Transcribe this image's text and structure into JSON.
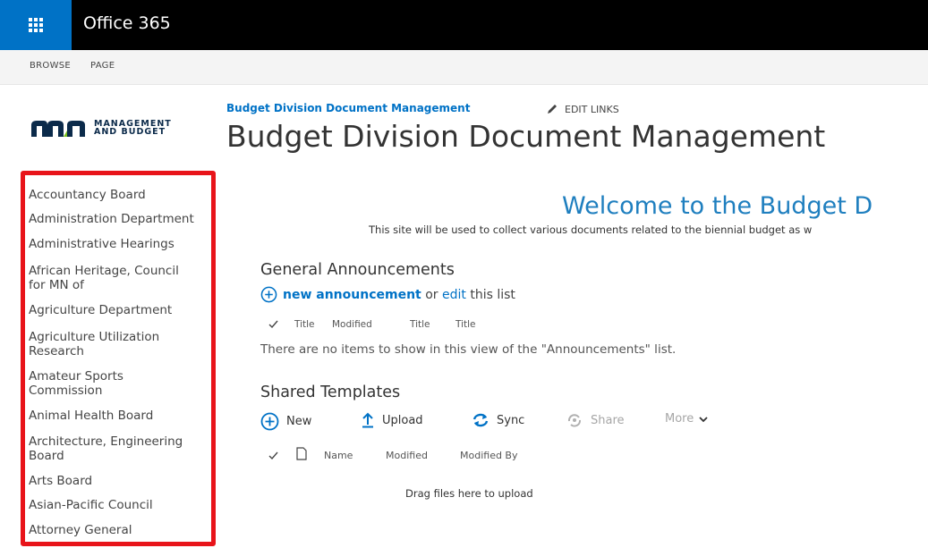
{
  "suite_bar": {
    "title": "Office 365",
    "waffle_icon": "app-launcher-waffle-icon"
  },
  "ribbon": {
    "tabs": [
      "BROWSE",
      "PAGE"
    ]
  },
  "logo": {
    "line1": "MANAGEMENT",
    "line2": "AND BUDGET",
    "brand_color": "#0b2a4a"
  },
  "header": {
    "breadcrumb": "Budget Division Document Management",
    "edit_links": "EDIT LINKS",
    "page_title": "Budget Division Document Management"
  },
  "left_nav": {
    "highlight_color": "#e8141a",
    "items": [
      "Accountancy Board",
      "Administration Department",
      "Administrative Hearings",
      "African Heritage, Council for MN of",
      "Agriculture Department",
      "Agriculture Utilization Research",
      "Amateur Sports Commission",
      "Animal Health Board",
      "Architecture, Engineering Board",
      "Arts Board",
      "Asian-Pacific Council",
      "Attorney General"
    ]
  },
  "welcome": {
    "heading": "Welcome to the Budget D",
    "description": "This site will be used to collect various documents related to the biennial budget as w"
  },
  "announcements": {
    "title": "General Announcements",
    "new_link": "new announcement",
    "or_text": "or",
    "edit_link": "edit",
    "this_list": "this list",
    "columns": [
      "Title",
      "Modified",
      "Title",
      "Title"
    ],
    "empty_message": "There are no items to show in this view of the \"Announcements\" list."
  },
  "templates": {
    "title": "Shared Templates",
    "commands": {
      "new": "New",
      "upload": "Upload",
      "sync": "Sync",
      "share": "Share",
      "more": "More"
    },
    "columns": {
      "name": "Name",
      "modified": "Modified",
      "modified_by": "Modified By"
    },
    "drag_message": "Drag files here to upload"
  },
  "colors": {
    "accent": "#0072c6",
    "suite_bar": "#000000",
    "welcome": "#1f7fbf"
  }
}
